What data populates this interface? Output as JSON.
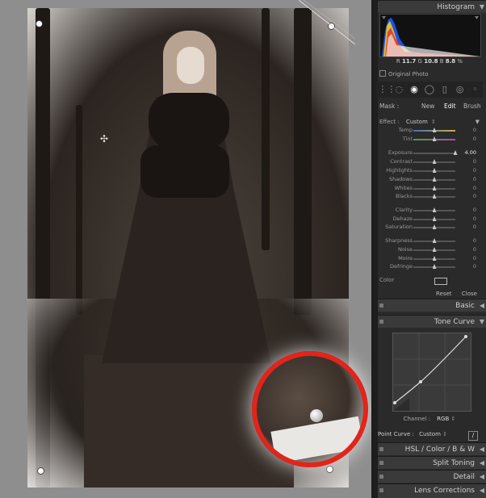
{
  "histogram": {
    "title": "Histogram",
    "readout": {
      "r_label": "R",
      "r_value": "11.7",
      "g_label": "G",
      "g_value": "10.8",
      "b_label": "B",
      "b_value": "8.8",
      "unit": "%"
    },
    "original_photo_label": "Original Photo"
  },
  "mask": {
    "label": "Mask :",
    "new": "New",
    "edit": "Edit",
    "brush": "Brush"
  },
  "effect": {
    "label": "Effect :",
    "value": "Custom"
  },
  "sliders": [
    {
      "label": "Temp",
      "value": "0",
      "position": 0.5
    },
    {
      "label": "Tint",
      "value": "0",
      "position": 0.5
    },
    {
      "label": "Exposure",
      "value": "4.00",
      "position": 1.0
    },
    {
      "label": "Contrast",
      "value": "0",
      "position": 0.5
    },
    {
      "label": "Highlights",
      "value": "0",
      "position": 0.5
    },
    {
      "label": "Shadows",
      "value": "0",
      "position": 0.5
    },
    {
      "label": "Whites",
      "value": "0",
      "position": 0.5
    },
    {
      "label": "Blacks",
      "value": "0",
      "position": 0.5
    },
    {
      "label": "Clarity",
      "value": "0",
      "position": 0.5
    },
    {
      "label": "Dehaze",
      "value": "0",
      "position": 0.5
    },
    {
      "label": "Saturation",
      "value": "0",
      "position": 0.5
    },
    {
      "label": "Sharpness",
      "value": "0",
      "position": 0.5
    },
    {
      "label": "Noise",
      "value": "0",
      "position": 0.5
    },
    {
      "label": "Moire",
      "value": "0",
      "position": 0.5
    },
    {
      "label": "Defringe",
      "value": "0",
      "position": 0.5
    }
  ],
  "color_label": "Color",
  "reset_label": "Reset",
  "close_label": "Close",
  "panels": {
    "basic": "Basic",
    "tone_curve": "Tone Curve",
    "hsl": "HSL / Color / B & W",
    "split_toning": "Split Toning",
    "detail": "Detail",
    "lens_corrections": "Lens Corrections"
  },
  "tone_curve": {
    "channel_label": "Channel :",
    "channel_value": "RGB",
    "point_curve_label": "Point Curve :",
    "point_curve_value": "Custom"
  },
  "colors": {
    "accent_red": "#e2241b",
    "panel_bg": "#2a2a2a",
    "header_bg": "#3a3a3a"
  }
}
